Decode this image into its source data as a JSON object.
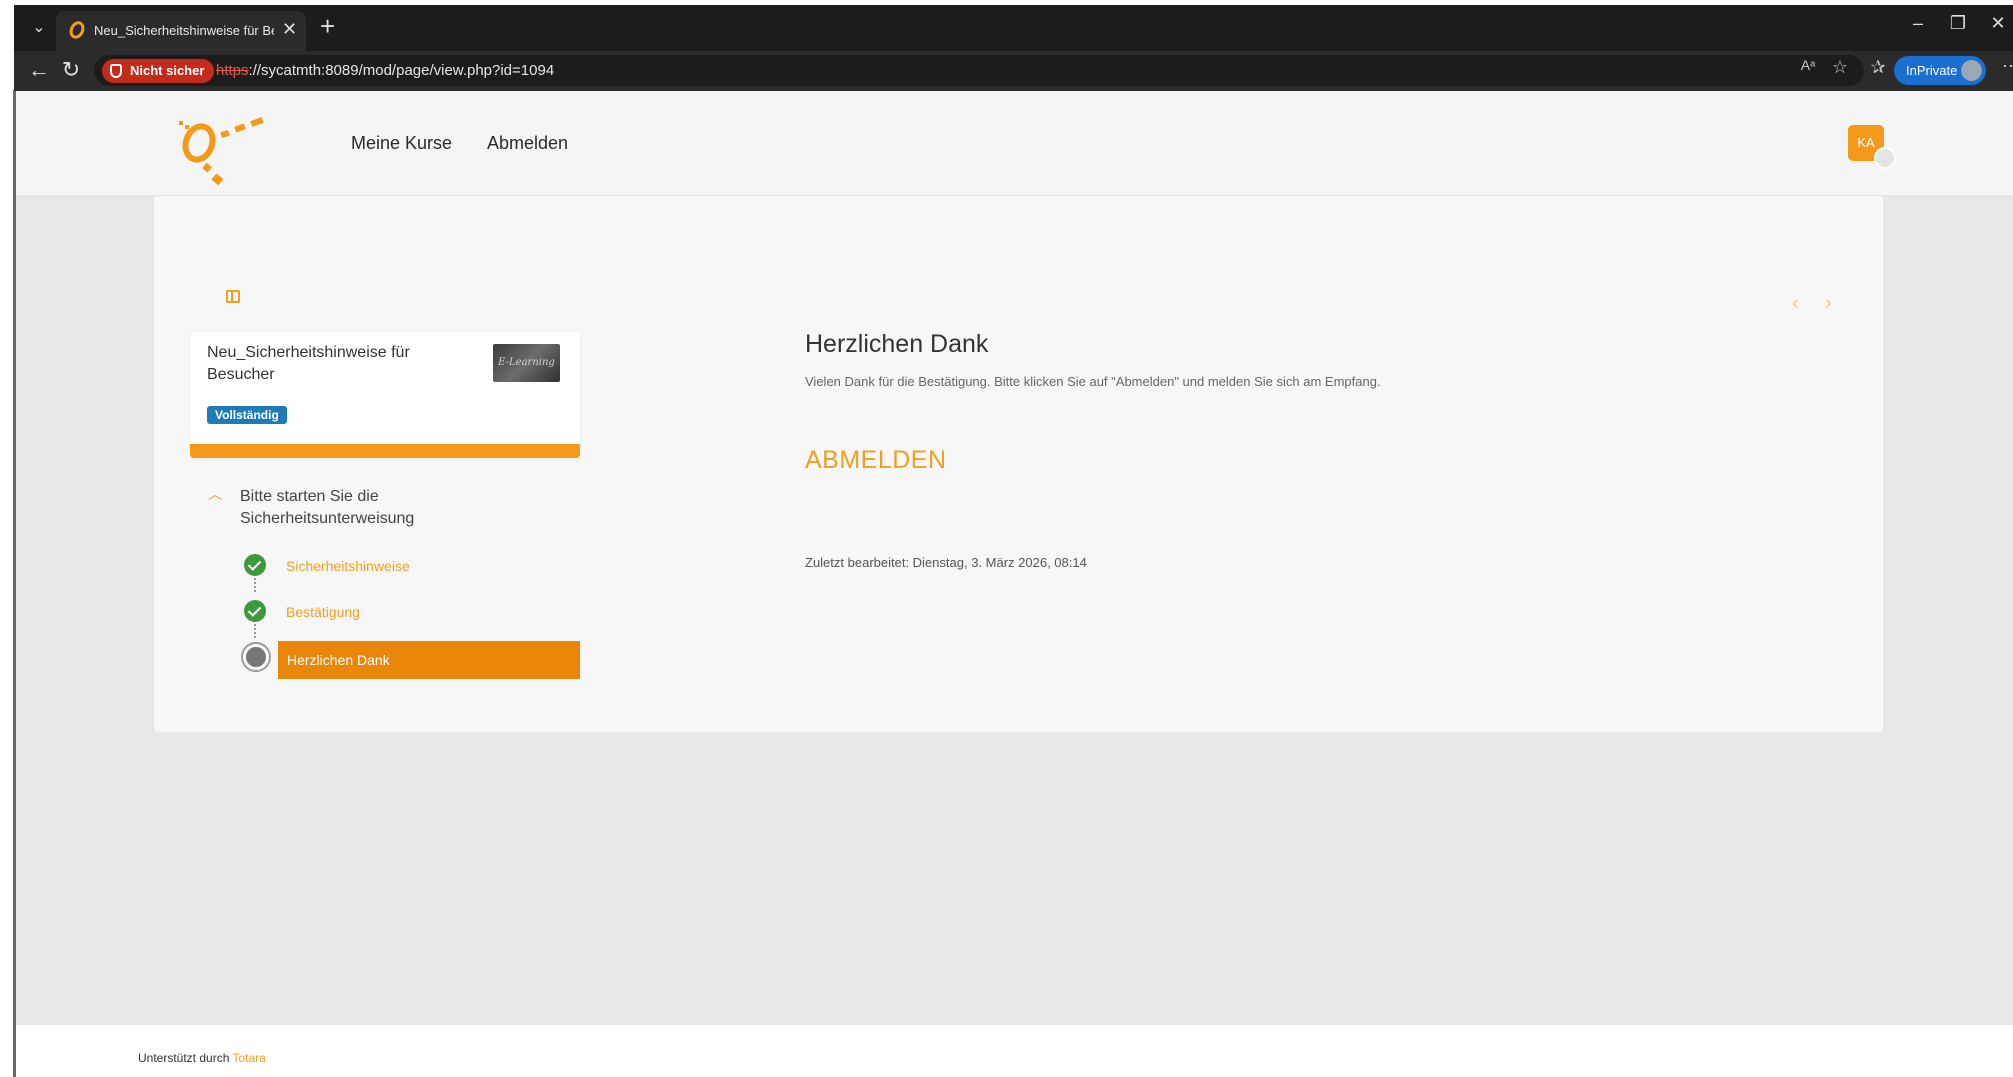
{
  "browser": {
    "tab_title": "Neu_Sicherheitshinweise für Besucher",
    "tab_close": "✕",
    "new_tab": "+",
    "not_secure_label": "Nicht sicher",
    "url_protocol": "https",
    "url_rest": "://sycatmth:8089/mod/page/view.php?id=1094",
    "inprivate_label": "InPrivate"
  },
  "header": {
    "nav_items": [
      "Meine Kurse",
      "Abmelden"
    ],
    "user_initials": "KA",
    "accent_color": "#f39a1a"
  },
  "course": {
    "title": "Neu_Sicherheitshinweise für Besucher",
    "thumbnail_text": "E-Learning",
    "status_badge": "Vollständig",
    "progress_percent": 100
  },
  "section": {
    "title": "Bitte starten Sie die Sicherheitsunterweisung",
    "activities": [
      {
        "label": "Sicherheitshinweise",
        "status": "complete"
      },
      {
        "label": "Bestätigung",
        "status": "complete"
      },
      {
        "label": "Herzlichen Dank",
        "status": "current"
      }
    ]
  },
  "content": {
    "title": "Herzlichen Dank",
    "text": "Vielen Dank für die Bestätigung. Bitte klicken Sie auf \"Abmelden\" und melden Sie sich am Empfang.",
    "link_label": "ABMELDEN",
    "last_modified": "Zuletzt bearbeitet: Dienstag, 3. März 2026, 08:14"
  },
  "footer": {
    "prefix": "Unterstützt durch",
    "brand": "Totara"
  }
}
